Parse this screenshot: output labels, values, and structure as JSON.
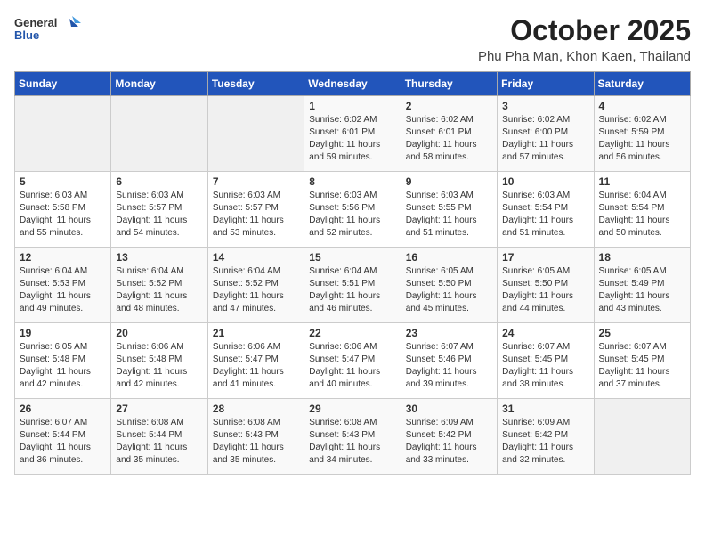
{
  "logo": {
    "general": "General",
    "blue": "Blue"
  },
  "title": "October 2025",
  "subtitle": "Phu Pha Man, Khon Kaen, Thailand",
  "days_of_week": [
    "Sunday",
    "Monday",
    "Tuesday",
    "Wednesday",
    "Thursday",
    "Friday",
    "Saturday"
  ],
  "weeks": [
    [
      {
        "day": "",
        "info": ""
      },
      {
        "day": "",
        "info": ""
      },
      {
        "day": "",
        "info": ""
      },
      {
        "day": "1",
        "info": "Sunrise: 6:02 AM\nSunset: 6:01 PM\nDaylight: 11 hours and 59 minutes."
      },
      {
        "day": "2",
        "info": "Sunrise: 6:02 AM\nSunset: 6:01 PM\nDaylight: 11 hours and 58 minutes."
      },
      {
        "day": "3",
        "info": "Sunrise: 6:02 AM\nSunset: 6:00 PM\nDaylight: 11 hours and 57 minutes."
      },
      {
        "day": "4",
        "info": "Sunrise: 6:02 AM\nSunset: 5:59 PM\nDaylight: 11 hours and 56 minutes."
      }
    ],
    [
      {
        "day": "5",
        "info": "Sunrise: 6:03 AM\nSunset: 5:58 PM\nDaylight: 11 hours and 55 minutes."
      },
      {
        "day": "6",
        "info": "Sunrise: 6:03 AM\nSunset: 5:57 PM\nDaylight: 11 hours and 54 minutes."
      },
      {
        "day": "7",
        "info": "Sunrise: 6:03 AM\nSunset: 5:57 PM\nDaylight: 11 hours and 53 minutes."
      },
      {
        "day": "8",
        "info": "Sunrise: 6:03 AM\nSunset: 5:56 PM\nDaylight: 11 hours and 52 minutes."
      },
      {
        "day": "9",
        "info": "Sunrise: 6:03 AM\nSunset: 5:55 PM\nDaylight: 11 hours and 51 minutes."
      },
      {
        "day": "10",
        "info": "Sunrise: 6:03 AM\nSunset: 5:54 PM\nDaylight: 11 hours and 51 minutes."
      },
      {
        "day": "11",
        "info": "Sunrise: 6:04 AM\nSunset: 5:54 PM\nDaylight: 11 hours and 50 minutes."
      }
    ],
    [
      {
        "day": "12",
        "info": "Sunrise: 6:04 AM\nSunset: 5:53 PM\nDaylight: 11 hours and 49 minutes."
      },
      {
        "day": "13",
        "info": "Sunrise: 6:04 AM\nSunset: 5:52 PM\nDaylight: 11 hours and 48 minutes."
      },
      {
        "day": "14",
        "info": "Sunrise: 6:04 AM\nSunset: 5:52 PM\nDaylight: 11 hours and 47 minutes."
      },
      {
        "day": "15",
        "info": "Sunrise: 6:04 AM\nSunset: 5:51 PM\nDaylight: 11 hours and 46 minutes."
      },
      {
        "day": "16",
        "info": "Sunrise: 6:05 AM\nSunset: 5:50 PM\nDaylight: 11 hours and 45 minutes."
      },
      {
        "day": "17",
        "info": "Sunrise: 6:05 AM\nSunset: 5:50 PM\nDaylight: 11 hours and 44 minutes."
      },
      {
        "day": "18",
        "info": "Sunrise: 6:05 AM\nSunset: 5:49 PM\nDaylight: 11 hours and 43 minutes."
      }
    ],
    [
      {
        "day": "19",
        "info": "Sunrise: 6:05 AM\nSunset: 5:48 PM\nDaylight: 11 hours and 42 minutes."
      },
      {
        "day": "20",
        "info": "Sunrise: 6:06 AM\nSunset: 5:48 PM\nDaylight: 11 hours and 42 minutes."
      },
      {
        "day": "21",
        "info": "Sunrise: 6:06 AM\nSunset: 5:47 PM\nDaylight: 11 hours and 41 minutes."
      },
      {
        "day": "22",
        "info": "Sunrise: 6:06 AM\nSunset: 5:47 PM\nDaylight: 11 hours and 40 minutes."
      },
      {
        "day": "23",
        "info": "Sunrise: 6:07 AM\nSunset: 5:46 PM\nDaylight: 11 hours and 39 minutes."
      },
      {
        "day": "24",
        "info": "Sunrise: 6:07 AM\nSunset: 5:45 PM\nDaylight: 11 hours and 38 minutes."
      },
      {
        "day": "25",
        "info": "Sunrise: 6:07 AM\nSunset: 5:45 PM\nDaylight: 11 hours and 37 minutes."
      }
    ],
    [
      {
        "day": "26",
        "info": "Sunrise: 6:07 AM\nSunset: 5:44 PM\nDaylight: 11 hours and 36 minutes."
      },
      {
        "day": "27",
        "info": "Sunrise: 6:08 AM\nSunset: 5:44 PM\nDaylight: 11 hours and 35 minutes."
      },
      {
        "day": "28",
        "info": "Sunrise: 6:08 AM\nSunset: 5:43 PM\nDaylight: 11 hours and 35 minutes."
      },
      {
        "day": "29",
        "info": "Sunrise: 6:08 AM\nSunset: 5:43 PM\nDaylight: 11 hours and 34 minutes."
      },
      {
        "day": "30",
        "info": "Sunrise: 6:09 AM\nSunset: 5:42 PM\nDaylight: 11 hours and 33 minutes."
      },
      {
        "day": "31",
        "info": "Sunrise: 6:09 AM\nSunset: 5:42 PM\nDaylight: 11 hours and 32 minutes."
      },
      {
        "day": "",
        "info": ""
      }
    ]
  ]
}
